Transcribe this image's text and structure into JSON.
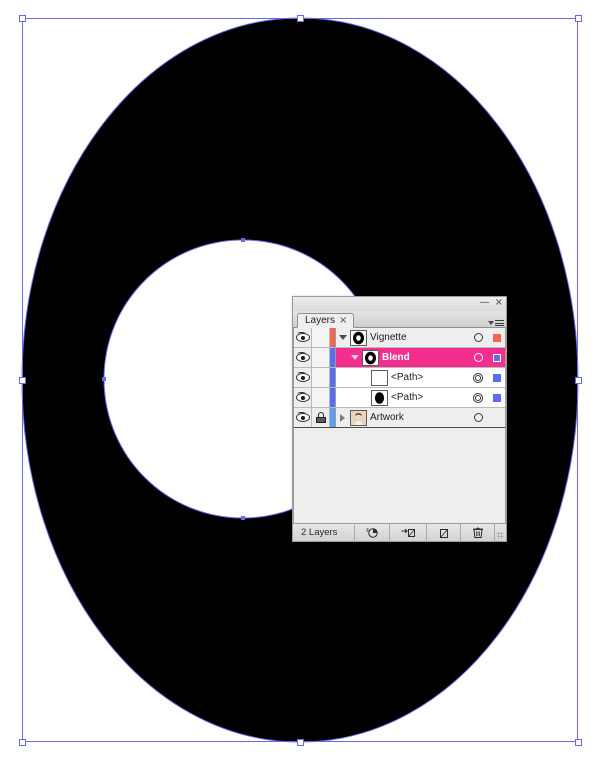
{
  "app": {
    "title": "Layers"
  },
  "canvas": {
    "background_color": "#ffffff",
    "shape_fill": "#000000",
    "selection_color": "#6a6ae8",
    "shape_name": "vignette-ring"
  },
  "panel": {
    "tab_label": "Layers",
    "tab_close_glyph": "×",
    "minimize_glyph": "—",
    "close_glyph": "×",
    "flyout_name": "panel-menu-icon",
    "footer": {
      "count_label": "2 Layers",
      "buttons": [
        {
          "name": "make-clipping-mask-button",
          "glyph": "◔"
        },
        {
          "name": "create-new-sublayer-button",
          "glyph": "↳"
        },
        {
          "name": "create-new-layer-button",
          "glyph": "◱"
        },
        {
          "name": "delete-selection-button",
          "glyph": "Ὕ1"
        }
      ]
    },
    "rows": [
      {
        "name": "Vignette",
        "type": "layer",
        "indent": 0,
        "visible": true,
        "locked": false,
        "expanded": true,
        "has_disclosure": true,
        "selected": false,
        "color": "#f4654f",
        "thumb": "ring",
        "target": "single",
        "sel_square": "#f4654f",
        "row_bg": "#eeeeee"
      },
      {
        "name": "Blend",
        "type": "group",
        "indent": 1,
        "visible": true,
        "locked": false,
        "expanded": true,
        "has_disclosure": true,
        "selected": true,
        "color": "#5a6ff0",
        "thumb": "ring",
        "target": "single",
        "sel_square": "#5a6ff0",
        "row_bg": "#f32e8e"
      },
      {
        "name": "<Path>",
        "type": "path",
        "indent": 2,
        "visible": true,
        "locked": false,
        "expanded": false,
        "has_disclosure": false,
        "selected": false,
        "color": "#5a6ff0",
        "thumb": "white-square",
        "target": "double",
        "sel_square": "#5a6ff0",
        "row_bg": "#ffffff"
      },
      {
        "name": "<Path>",
        "type": "path",
        "indent": 2,
        "visible": true,
        "locked": false,
        "expanded": false,
        "has_disclosure": false,
        "selected": false,
        "color": "#5a6ff0",
        "thumb": "black-ellipse",
        "target": "double",
        "sel_square": "#5a6ff0",
        "row_bg": "#ffffff"
      },
      {
        "name": "Artwork",
        "type": "layer",
        "indent": 0,
        "visible": true,
        "locked": true,
        "expanded": false,
        "has_disclosure": true,
        "selected": false,
        "color": "#5a9ff0",
        "thumb": "portrait",
        "target": "single",
        "sel_square": "",
        "row_bg": "#eeeeee"
      }
    ]
  }
}
